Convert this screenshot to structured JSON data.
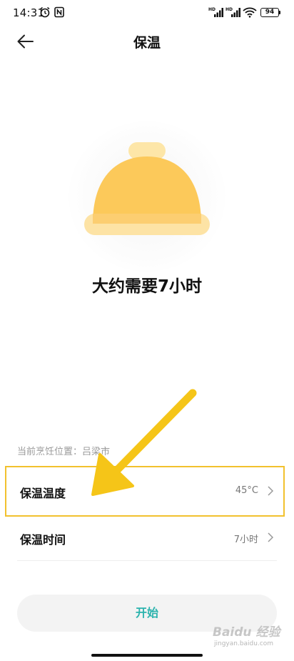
{
  "status_bar": {
    "time": "14:31",
    "battery": "94",
    "signal_label": "HD"
  },
  "header": {
    "title": "保温"
  },
  "illustration": {
    "icon": "food-cover-bell-icon",
    "colors": {
      "dome": "#fcc95a",
      "base": "#fde2a0",
      "handle": "#fde6a8"
    }
  },
  "duration_text": "大约需要7小时",
  "location_line": "当前烹饪位置：吕梁市",
  "settings": [
    {
      "label": "保温温度",
      "value": "45°C"
    },
    {
      "label": "保温时间",
      "value": "7小时"
    }
  ],
  "start_button": {
    "label": "开始",
    "color": "#2bb3ad"
  },
  "annotation": {
    "highlight_color": "#f2c12e",
    "arrow_color": "#f5c518"
  },
  "watermark": {
    "brand": "Baidu 经验",
    "url": "jingyan.baidu.com"
  }
}
